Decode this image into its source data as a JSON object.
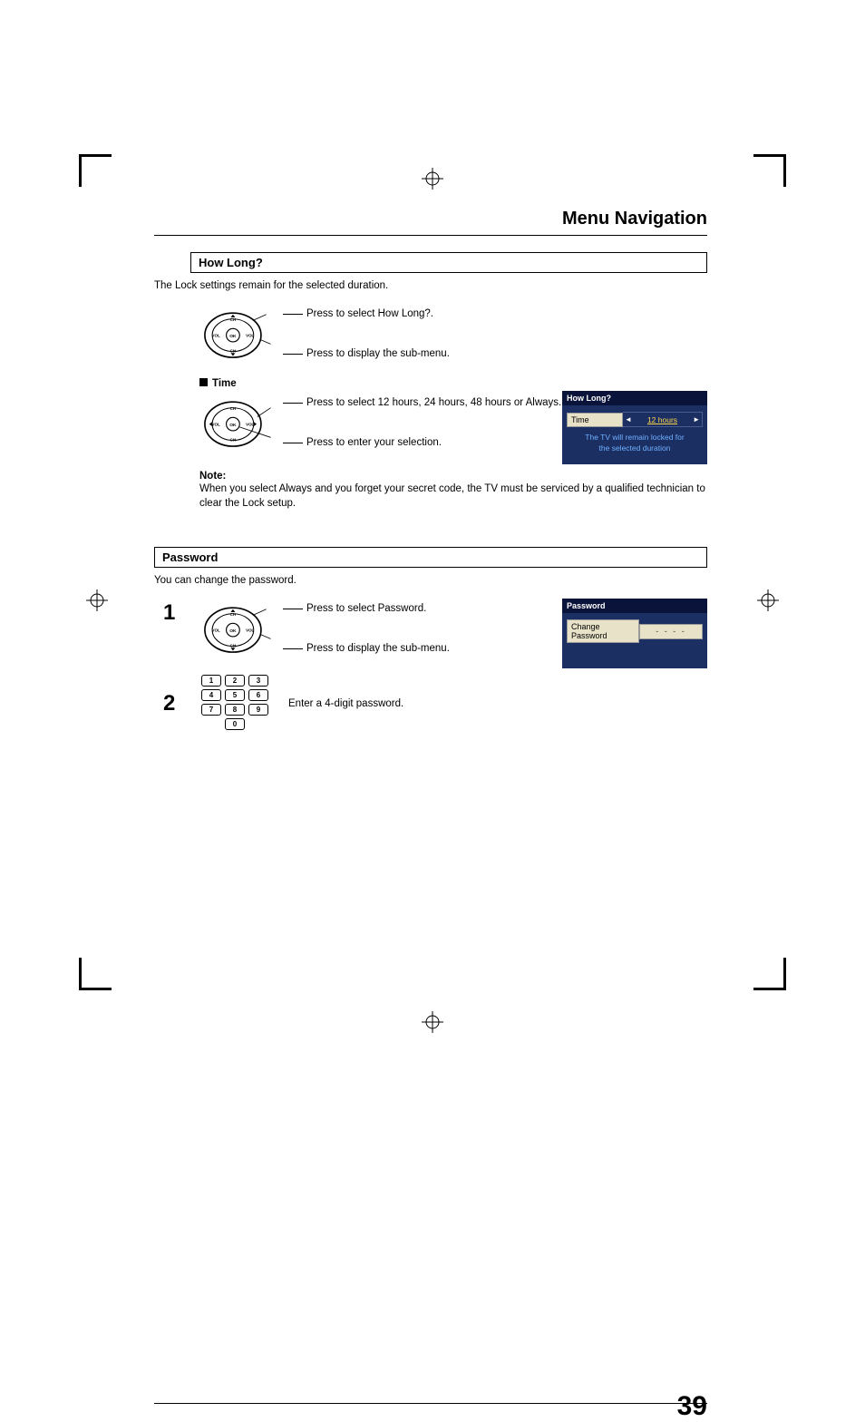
{
  "header": {
    "title": "Menu Navigation"
  },
  "howlong": {
    "heading": "How Long?",
    "intro": "The Lock settings remain for the selected duration.",
    "d1": "Press to select How Long?.",
    "d2": "Press to display the sub-menu.",
    "time_heading": "Time",
    "td1": "Press to select 12 hours, 24 hours, 48 hours or Always.",
    "td2": "Press to enter your selection.",
    "note_h": "Note:",
    "note_t": "When you select Always and you forget your secret code, the TV must be serviced by a qualified technician to clear the Lock setup."
  },
  "osd1": {
    "title": "How Long?",
    "row_label": "Time",
    "row_value": "12 hours",
    "note_l1": "The TV will remain locked for",
    "note_l2": "the selected duration"
  },
  "password": {
    "heading": "Password",
    "intro": "You can change the password.",
    "step1_n": "1",
    "s1d1": "Press to select Password.",
    "s1d2": "Press to display the sub-menu.",
    "step2_n": "2",
    "s2d": "Enter a 4-digit password."
  },
  "osd2": {
    "title": "Password",
    "row_label": "Change Password",
    "row_value": "- - - -"
  },
  "keypad": {
    "k1": "1",
    "k2": "2",
    "k3": "3",
    "k4": "4",
    "k5": "5",
    "k6": "6",
    "k7": "7",
    "k8": "8",
    "k9": "9",
    "k0": "0"
  },
  "remote": {
    "ch": "CH",
    "vol": "VOL",
    "ok": "OK"
  },
  "page_number": "39"
}
